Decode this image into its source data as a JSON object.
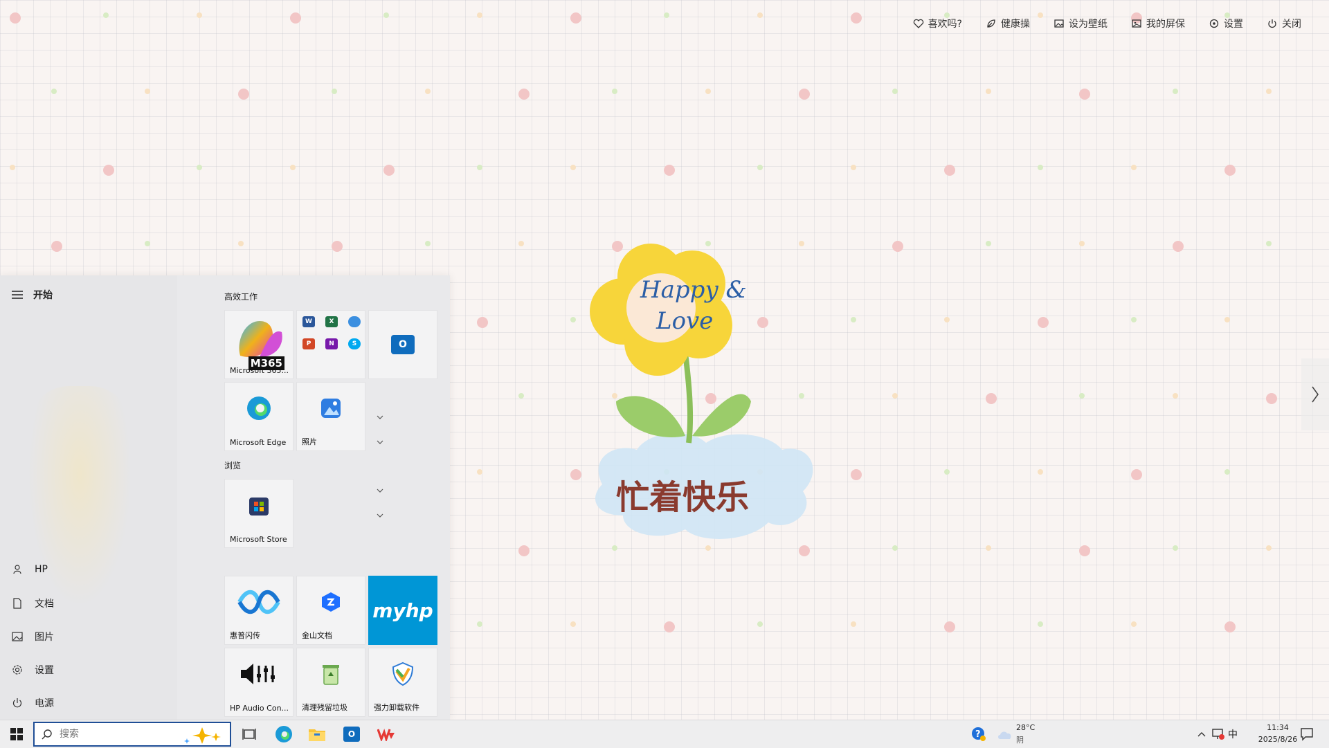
{
  "toolbar": {
    "items": [
      {
        "label": "喜欢吗?",
        "icon": "heart-icon"
      },
      {
        "label": "健康操",
        "icon": "leaf-icon"
      },
      {
        "label": "设为壁纸",
        "icon": "wallpaper-icon"
      },
      {
        "label": "我的屏保",
        "icon": "screensaver-icon"
      },
      {
        "label": "设置",
        "icon": "gear-icon"
      },
      {
        "label": "关闭",
        "icon": "power-icon"
      }
    ]
  },
  "artwork": {
    "flower_text_line1": "Happy &",
    "flower_text_line2": "Love",
    "cloud_text": "忙着快乐"
  },
  "start_menu": {
    "title": "开始",
    "left_items": [
      {
        "label": "HP",
        "icon": "user-icon"
      },
      {
        "label": "文档",
        "icon": "document-icon"
      },
      {
        "label": "图片",
        "icon": "picture-icon"
      },
      {
        "label": "设置",
        "icon": "gear-icon"
      },
      {
        "label": "电源",
        "icon": "power-icon"
      }
    ],
    "groups": [
      {
        "label": "高效工作"
      },
      {
        "label": "浏览"
      }
    ],
    "tiles": {
      "m365": {
        "label": "Microsoft 365...",
        "badge": "M365"
      },
      "office": {
        "label": ""
      },
      "outlook": {
        "label": ""
      },
      "edge": {
        "label": "Microsoft Edge"
      },
      "photos": {
        "label": "照片"
      },
      "store": {
        "label": "Microsoft Store"
      },
      "hp_share": {
        "label": "惠普闪传"
      },
      "wps_docs": {
        "label": "金山文档"
      },
      "myhp": {
        "label": "",
        "logo_text": "myhp"
      },
      "hp_audio": {
        "label": "HP Audio Con..."
      },
      "cleaner": {
        "label": "清理残留垃圾"
      },
      "uninstaller": {
        "label": "强力卸载软件"
      }
    }
  },
  "taskbar": {
    "search_placeholder": "搜索",
    "weather_temp": "28°C",
    "weather_desc": "阴",
    "ime": "中",
    "time": "11:34",
    "date": "2025/8/26"
  },
  "colors": {
    "accent": "#1f4e96",
    "myhp_blue": "#0096d6",
    "flower_yellow": "#f7d53a"
  }
}
